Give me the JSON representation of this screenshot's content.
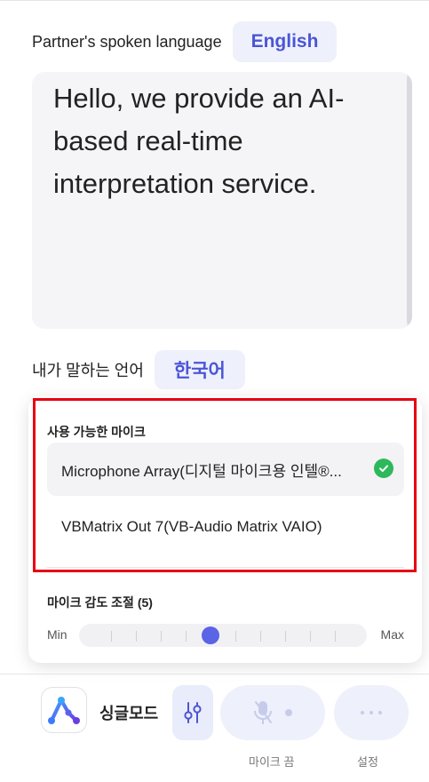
{
  "partner": {
    "label": "Partner's spoken language",
    "language": "English"
  },
  "transcript": {
    "text": "Hello, we provide an AI-based real-time interpretation service."
  },
  "mine": {
    "label": "내가 말하는 언어",
    "language": "한국어"
  },
  "mic_popup": {
    "title": "사용 가능한 마이크",
    "items": [
      {
        "label": "Microphone Array(디지털 마이크용 인텔®...",
        "selected": true
      },
      {
        "label": "VBMatrix Out 7(VB-Audio Matrix VAIO)",
        "selected": false
      }
    ],
    "sensitivity": {
      "title": "마이크 감도 조절 (5)",
      "min_label": "Min",
      "max_label": "Max",
      "level": 5,
      "steps": 10
    }
  },
  "bottom_bar": {
    "mode_label": "싱글모드",
    "mic_off_label": "마이크 끔",
    "settings_label": "설정"
  },
  "colors": {
    "accent": "#4b55d6",
    "slider_thumb": "#5b63e6",
    "check": "#2eb85c",
    "highlight": "#e60012"
  },
  "icons": [
    "check-icon",
    "sliders-icon",
    "mic-off-icon",
    "more-icon",
    "app-logo-icon"
  ]
}
